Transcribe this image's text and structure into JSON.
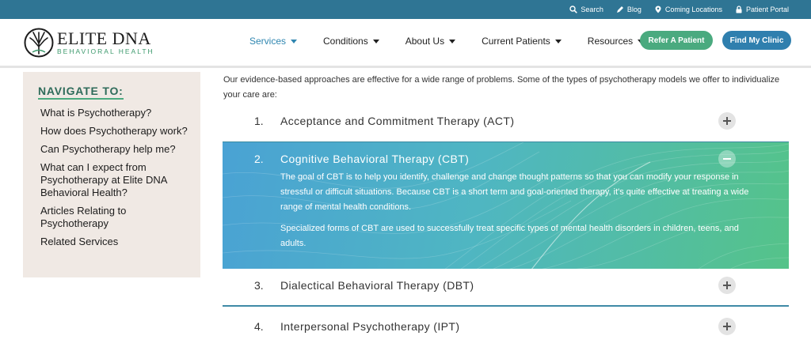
{
  "utility_links": [
    {
      "icon": "search-icon",
      "label": "Search"
    },
    {
      "icon": "pencil-icon",
      "label": "Blog"
    },
    {
      "icon": "location-pin-icon",
      "label": "Coming Locations"
    },
    {
      "icon": "lock-icon",
      "label": "Patient Portal"
    }
  ],
  "logo": {
    "name": "ELITE DNA",
    "tagline": "BEHAVIORAL HEALTH"
  },
  "nav": [
    {
      "label": "Services",
      "active": true
    },
    {
      "label": "Conditions"
    },
    {
      "label": "About Us"
    },
    {
      "label": "Current Patients"
    },
    {
      "label": "Resources"
    }
  ],
  "buttons": {
    "refer": "Refer A Patient",
    "clinic": "Find My Clinic"
  },
  "sidebar": {
    "title": "NAVIGATE TO:",
    "items": [
      "What is Psychotherapy?",
      "How does Psychotherapy work?",
      "Can Psychotherapy help me?",
      "What can I expect from Psychotherapy at Elite DNA Behavioral Health?",
      "Articles Relating to Psychotherapy",
      "Related Services"
    ]
  },
  "intro": "Our evidence-based approaches are effective for a wide range of problems. Some of the types of psychotherapy models we offer to individualize your care are:",
  "accordion": [
    {
      "num": "1.",
      "title": "Acceptance and Commitment Therapy (ACT)",
      "expanded": false
    },
    {
      "num": "2.",
      "title": "Cognitive Behavioral Therapy (CBT)",
      "expanded": true,
      "body": [
        "The goal of CBT is to help you identify, challenge and change thought patterns so that you can modify your response in stressful or difficult situations. Because CBT is a short term and goal-oriented therapy, it's quite effective at treating a wide range of mental health conditions.",
        "Specialized forms of CBT are used to successfully treat specific types of mental health disorders in children, teens, and adults."
      ]
    },
    {
      "num": "3.",
      "title": "Dialectical Behavioral Therapy (DBT)",
      "expanded": false
    },
    {
      "num": "4.",
      "title": "Interpersonal Psychotherapy (IPT)",
      "expanded": false
    }
  ],
  "colors": {
    "topbar": "#2f7594",
    "accent_green": "#4aaa7f",
    "accent_blue": "#2f7fae",
    "sidebar_bg": "#f0e9e4"
  }
}
